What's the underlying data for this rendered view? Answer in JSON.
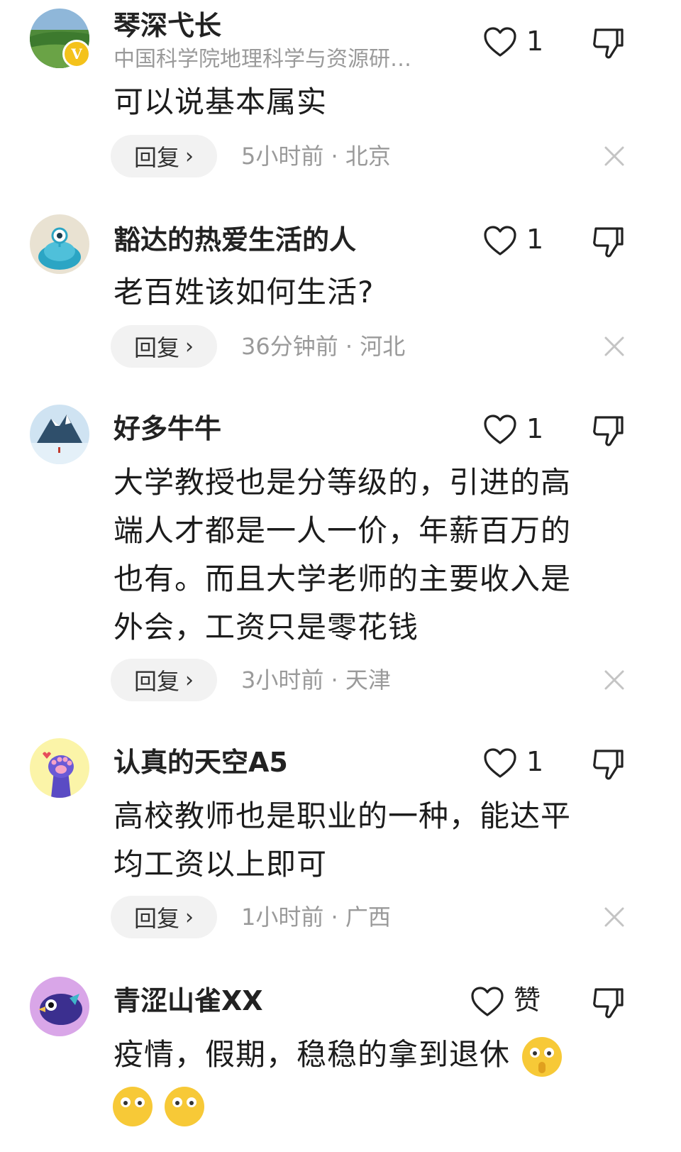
{
  "comments": [
    {
      "username": "琴深弋长",
      "affiliation": "中国科学院地理科学与资源研…",
      "verified_badge": "V",
      "text": "可以说基本属实",
      "like_count": "1",
      "reply_label": "回复",
      "meta": "5小时前 · 北京",
      "avatar_icon": "landscape-avatar-icon"
    },
    {
      "username": "豁达的热爱生活的人",
      "text": "老百姓该如何生活?",
      "like_count": "1",
      "reply_label": "回复",
      "meta": "36分钟前 · 河北",
      "avatar_icon": "alien-avatar-icon"
    },
    {
      "username": "好多牛牛",
      "text_lines": [
        "大学教授也是分等级的，引进的高",
        "端人才都是一人一价，年薪百万的",
        "也有。而且大学老师的主要收入是",
        "外会，工资只是零花钱"
      ],
      "like_count": "1",
      "reply_label": "回复",
      "meta": "3小时前 · 天津",
      "avatar_icon": "iceberg-avatar-icon"
    },
    {
      "username": "认真的天空A5",
      "text_lines": [
        "高校教师也是职业的一种，能达平",
        "均工资以上即可"
      ],
      "like_count": "1",
      "reply_label": "回复",
      "meta": "1小时前 · 广西",
      "avatar_icon": "paw-avatar-icon"
    },
    {
      "username": "青涩山雀XX",
      "text": "疫情，假期，稳稳的拿到退休",
      "like_label": "赞",
      "avatar_icon": "bird-avatar-icon",
      "emoji_icon": "shocked-face-emoji-icon"
    }
  ],
  "colors": {
    "username": "#222222",
    "meta": "#9a9a9a",
    "reply_bg": "#f2f2f2",
    "badge": "#f4c21b"
  }
}
